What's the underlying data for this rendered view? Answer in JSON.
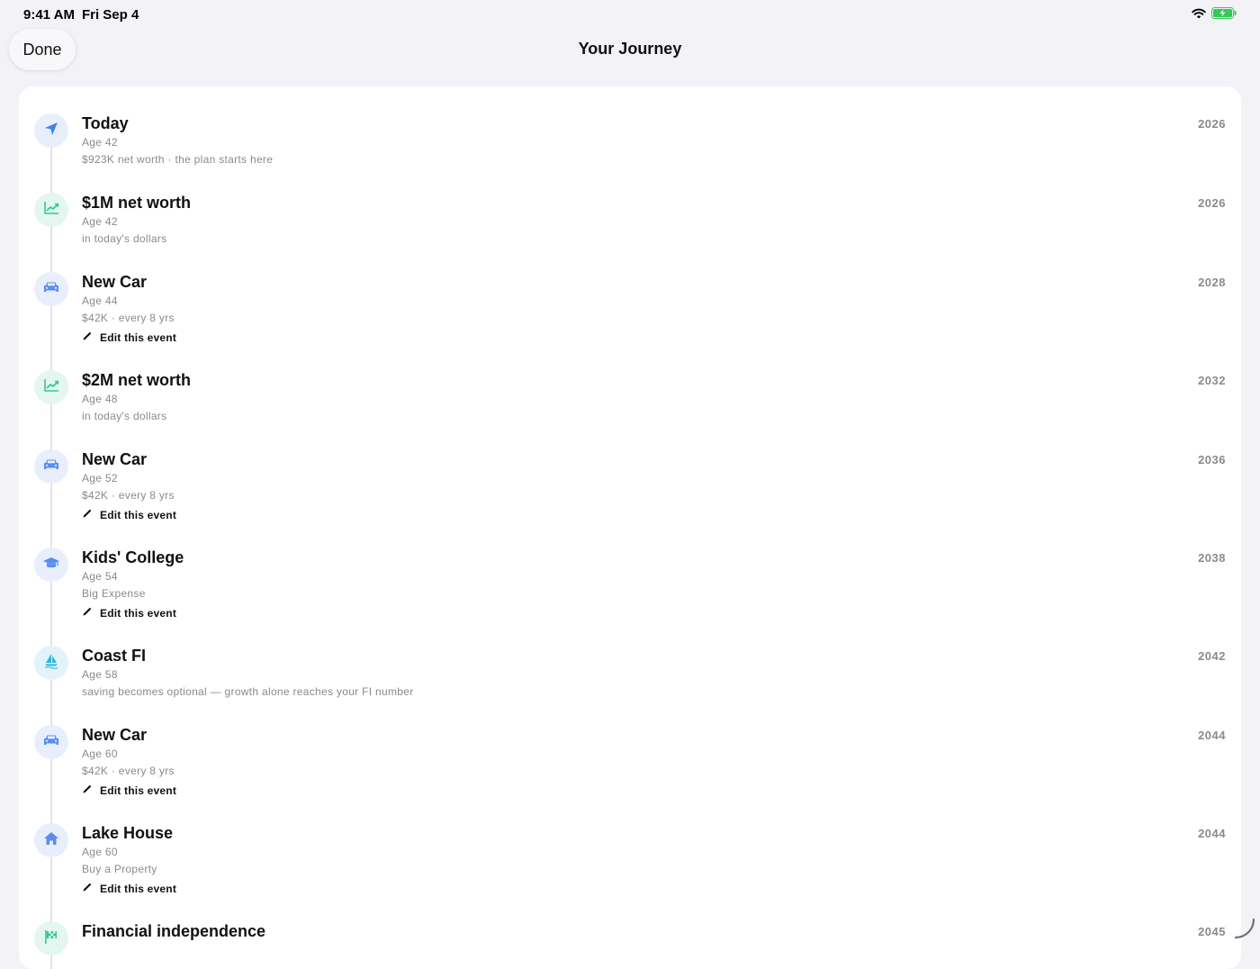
{
  "status_bar": {
    "time": "9:41 AM",
    "date": "Fri Sep 4",
    "wifi_icon": "wifi-icon",
    "battery_icon": "battery-charging-icon",
    "battery_color": "#34c759"
  },
  "nav": {
    "done_label": "Done",
    "title": "Your Journey"
  },
  "colors": {
    "blue_accent": "#3b82f6",
    "green_accent": "#34c7a0",
    "icon_bg_blue": "#e8eefc",
    "icon_bg_green": "#e3f6ef",
    "icon_bg_cyan": "#e2f4fa"
  },
  "events": [
    {
      "title": "Today",
      "age": "Age 42",
      "detail": "$923K net worth · the plan starts here",
      "year": "2026",
      "icon": "location-arrow-icon",
      "edit": null
    },
    {
      "title": "$1M net worth",
      "age": "Age 42",
      "detail": "in today's dollars",
      "year": "2026",
      "icon": "trend-chart-icon",
      "edit": null
    },
    {
      "title": "New Car",
      "age": "Age 44",
      "detail": "$42K · every 8 yrs",
      "year": "2028",
      "icon": "car-icon",
      "edit": "Edit this event"
    },
    {
      "title": "$2M net worth",
      "age": "Age 48",
      "detail": "in today's dollars",
      "year": "2032",
      "icon": "trend-chart-icon",
      "edit": null
    },
    {
      "title": "New Car",
      "age": "Age 52",
      "detail": "$42K · every 8 yrs",
      "year": "2036",
      "icon": "car-icon",
      "edit": "Edit this event"
    },
    {
      "title": "Kids' College",
      "age": "Age 54",
      "detail": "Big Expense",
      "year": "2038",
      "icon": "graduation-cap-icon",
      "edit": "Edit this event"
    },
    {
      "title": "Coast FI",
      "age": "Age 58",
      "detail": "saving becomes optional — growth alone reaches your FI number",
      "year": "2042",
      "icon": "sailboat-icon",
      "edit": null
    },
    {
      "title": "New Car",
      "age": "Age 60",
      "detail": "$42K · every 8 yrs",
      "year": "2044",
      "icon": "car-icon",
      "edit": "Edit this event"
    },
    {
      "title": "Lake House",
      "age": "Age 60",
      "detail": "Buy a Property",
      "year": "2044",
      "icon": "house-icon",
      "edit": "Edit this event"
    },
    {
      "title": "Financial independence",
      "age": "",
      "detail": "",
      "year": "2045",
      "icon": "finish-flag-icon",
      "edit": null
    }
  ]
}
